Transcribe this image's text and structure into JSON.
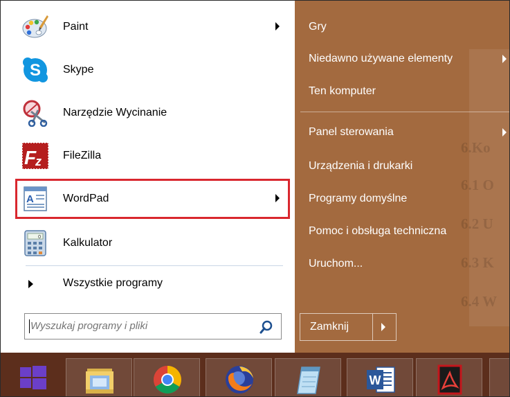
{
  "start_menu": {
    "left_items": [
      {
        "label": "Paint",
        "icon": "paint-icon",
        "has_submenu": true
      },
      {
        "label": "Skype",
        "icon": "skype-icon",
        "has_submenu": false
      },
      {
        "label": "Narzędzie Wycinanie",
        "icon": "snipping-tool-icon",
        "has_submenu": false
      },
      {
        "label": "FileZilla",
        "icon": "filezilla-icon",
        "has_submenu": false
      },
      {
        "label": "WordPad",
        "icon": "wordpad-icon",
        "has_submenu": true,
        "highlighted": true
      },
      {
        "label": "Kalkulator",
        "icon": "calculator-icon",
        "has_submenu": false
      }
    ],
    "all_programs_label": "Wszystkie programy",
    "search": {
      "placeholder": "Wyszukaj programy i pliki",
      "value": ""
    },
    "right_items": [
      {
        "label": "Gry",
        "has_submenu": false
      },
      {
        "label": "Niedawno używane elementy",
        "has_submenu": true
      },
      {
        "label": "Ten komputer",
        "has_submenu": false
      },
      {
        "label": "Panel sterowania",
        "has_submenu": true
      },
      {
        "label": "Urządzenia i drukarki",
        "has_submenu": false
      },
      {
        "label": "Programy domyślne",
        "has_submenu": false
      },
      {
        "label": "Pomoc i obsługa techniczna",
        "has_submenu": false
      },
      {
        "label": "Uruchom...",
        "has_submenu": false
      }
    ],
    "shutdown_label": "Zamknij",
    "background_document_text": [
      "6.Ko",
      "6.1 O",
      "6.2 U",
      "6.3 K",
      "6.4 W"
    ]
  },
  "taskbar": {
    "buttons": [
      {
        "name": "start-button",
        "icon": "windows-logo-icon"
      },
      {
        "name": "file-explorer",
        "icon": "folder-icon"
      },
      {
        "name": "chrome",
        "icon": "chrome-icon"
      },
      {
        "name": "firefox",
        "icon": "firefox-icon"
      },
      {
        "name": "notepad",
        "icon": "notepad-icon"
      },
      {
        "name": "word",
        "icon": "word-icon"
      },
      {
        "name": "acrobat",
        "icon": "acrobat-icon"
      }
    ]
  },
  "colors": {
    "right_panel": "#a36a3f",
    "taskbar": "#5c2e1c",
    "highlight_border": "#d9272e",
    "windows_logo": "#6b3fc8"
  }
}
